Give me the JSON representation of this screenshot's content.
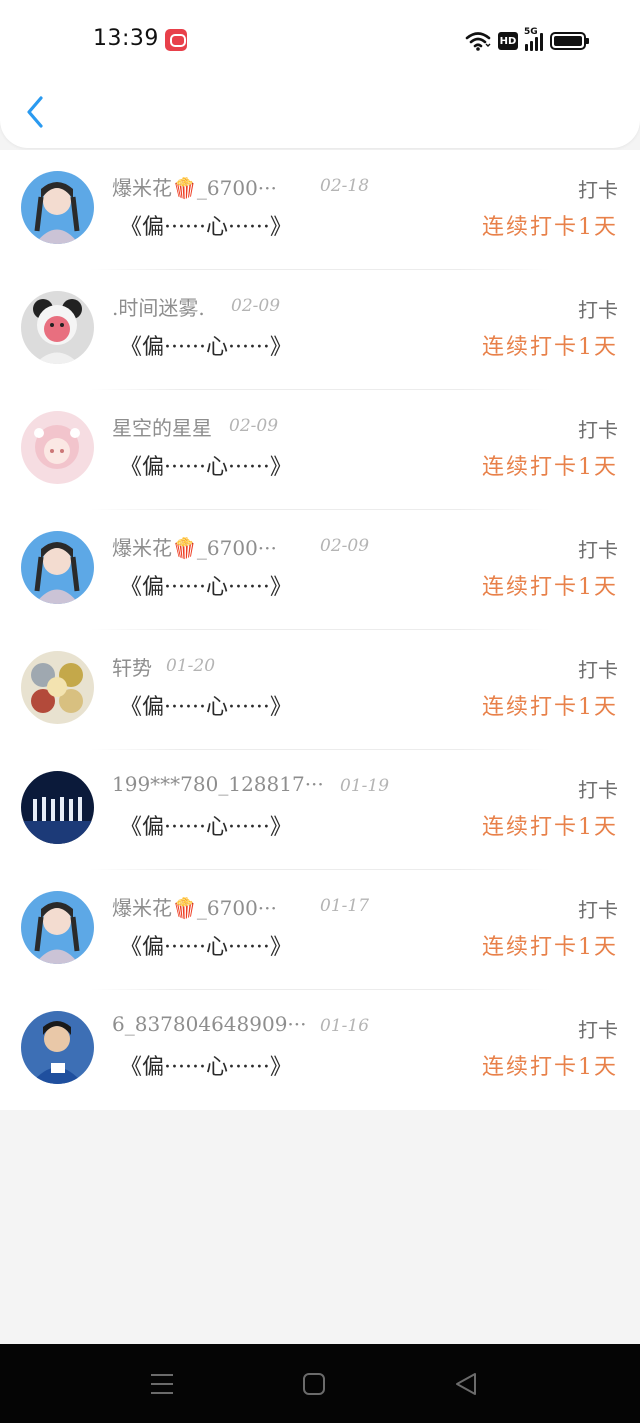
{
  "status_bar": {
    "time": "13:39",
    "app_icon": "video-app-icon",
    "icons": [
      "wifi-icon",
      "hd-icon",
      "5g-signal-icon",
      "battery-icon"
    ],
    "hd_label": "HD",
    "network_label": "5G",
    "signal_level": 1.0,
    "battery_level": 1.0
  },
  "header": {
    "back_icon": "chevron-left-icon",
    "accent_color": "#2a9af0"
  },
  "colors": {
    "streak": "#e8814a",
    "name": "#8e8e8e",
    "date": "#b4b4b4"
  },
  "records": [
    {
      "name": "爆米花🍿_6700···",
      "date": "02-18",
      "quote": "《偏······心······》",
      "type": "打卡",
      "streak": "连续打卡1天",
      "avatar": "girl-braids"
    },
    {
      "name": ".时间迷雾.",
      "date": "02-09",
      "quote": "《偏······心······》",
      "type": "打卡",
      "streak": "连续打卡1天",
      "avatar": "pink-bear"
    },
    {
      "name": "星空的星星",
      "date": "02-09",
      "quote": "《偏······心······》",
      "type": "打卡",
      "streak": "连续打卡1天",
      "avatar": "anime-girl"
    },
    {
      "name": "爆米花🍿_6700···",
      "date": "02-09",
      "quote": "《偏······心······》",
      "type": "打卡",
      "streak": "连续打卡1天",
      "avatar": "girl-braids"
    },
    {
      "name": "轩势",
      "date": "01-20",
      "quote": "《偏······心······》",
      "type": "打卡",
      "streak": "连续打卡1天",
      "avatar": "cartoon-group"
    },
    {
      "name": "199***780_128817···",
      "date": "01-19",
      "quote": "《偏······心······》",
      "type": "打卡",
      "streak": "连续打卡1天",
      "avatar": "stage-group"
    },
    {
      "name": "爆米花🍿_6700···",
      "date": "01-17",
      "quote": "《偏······心······》",
      "type": "打卡",
      "streak": "连续打卡1天",
      "avatar": "girl-braids"
    },
    {
      "name": "6_837804648909···",
      "date": "01-16",
      "quote": "《偏······心······》",
      "type": "打卡",
      "streak": "连续打卡1天",
      "avatar": "boy-blue"
    }
  ],
  "nav_bar": {
    "icons": [
      "menu-icon",
      "home-square-icon",
      "back-triangle-icon"
    ]
  }
}
